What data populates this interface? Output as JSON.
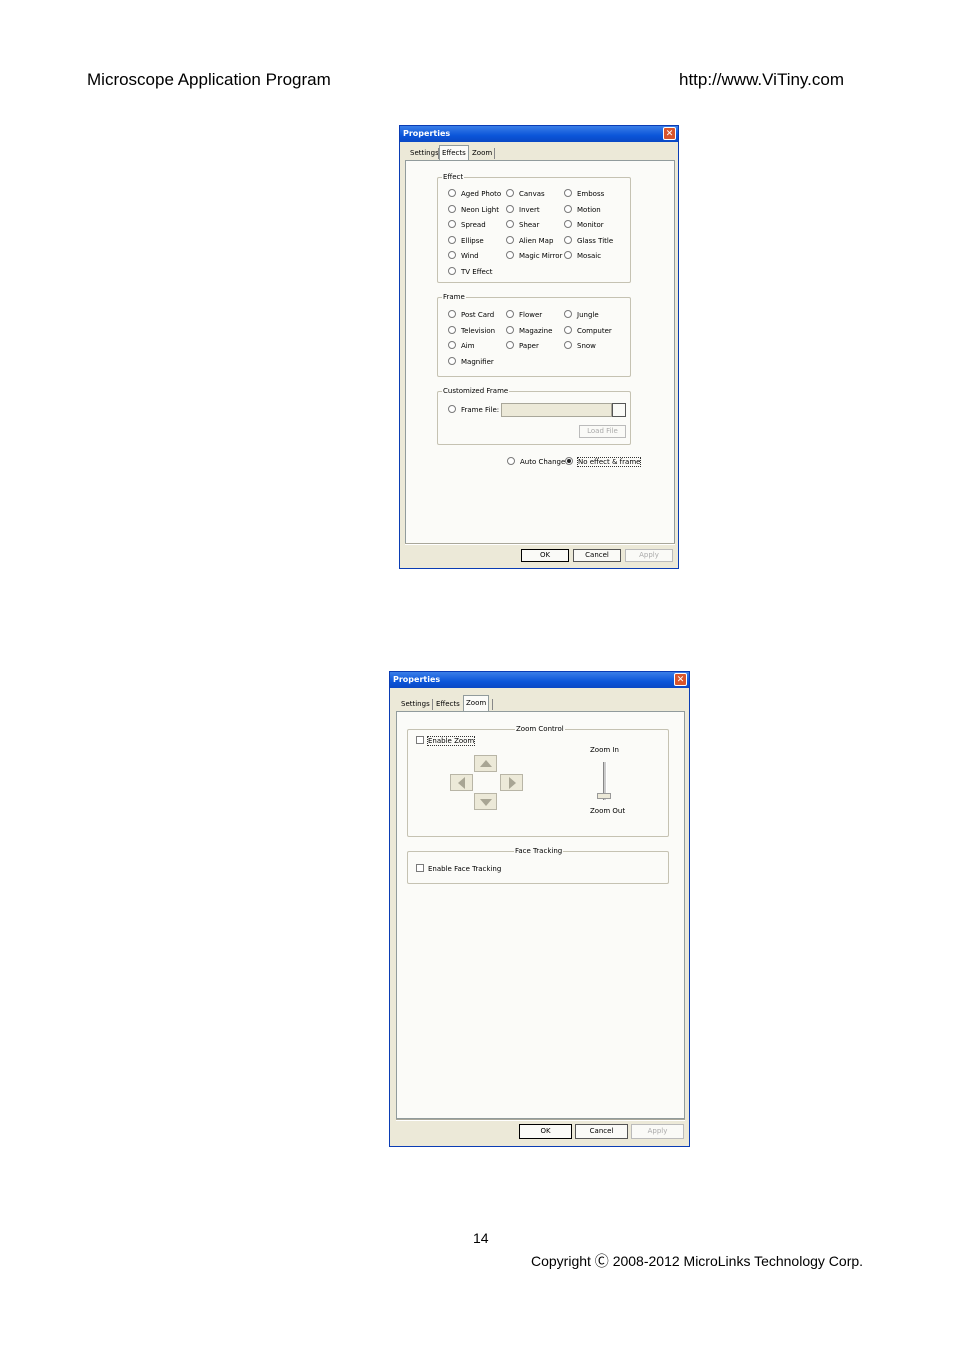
{
  "header": {
    "left": "Microscope Application Program",
    "right": "http://www.ViTiny.com"
  },
  "footer": {
    "page_number": "14",
    "copyright": "Copyright Ⓒ 2008-2012 MicroLinks Technology Corp."
  },
  "dialog1": {
    "title": "Properties",
    "close_glyph": "✕",
    "tabs": [
      "Settings",
      "Effects",
      "Zoom"
    ],
    "active_tab": "Effects",
    "effect_group": "Effect",
    "effects": [
      "Aged Photo",
      "Canvas",
      "Emboss",
      "Neon Light",
      "Invert",
      "Motion",
      "Spread",
      "Shear",
      "Monitor",
      "Ellipse",
      "Alien Map",
      "Glass Title",
      "Wind",
      "Magic Mirror",
      "Mosaic",
      "TV Effect"
    ],
    "frame_group": "Frame",
    "frames": [
      "Post Card",
      "Flower",
      "Jungle",
      "Television",
      "Magazine",
      "Computer",
      "Aim",
      "Paper",
      "Snow",
      "Magnifier"
    ],
    "custom_group": "Customized Frame",
    "frame_file_label": "Frame File:",
    "load_file": "Load File",
    "auto_change": "Auto Change",
    "no_effect": "No effect & frame",
    "selected": "No effect & frame",
    "ok": "OK",
    "cancel": "Cancel",
    "apply": "Apply"
  },
  "dialog2": {
    "title": "Properties",
    "close_glyph": "✕",
    "tabs": [
      "Settings",
      "Effects",
      "Zoom"
    ],
    "active_tab": "Zoom",
    "zoom_group": "Zoom Control",
    "enable_zoom": "Enable Zoom",
    "enable_zoom_checked": false,
    "zoom_in": "Zoom In",
    "zoom_out": "Zoom Out",
    "zoom_slider_level": 0,
    "face_group": "Face Tracking",
    "enable_face": "Enable Face Tracking",
    "enable_face_checked": false,
    "ok": "OK",
    "cancel": "Cancel",
    "apply": "Apply"
  }
}
